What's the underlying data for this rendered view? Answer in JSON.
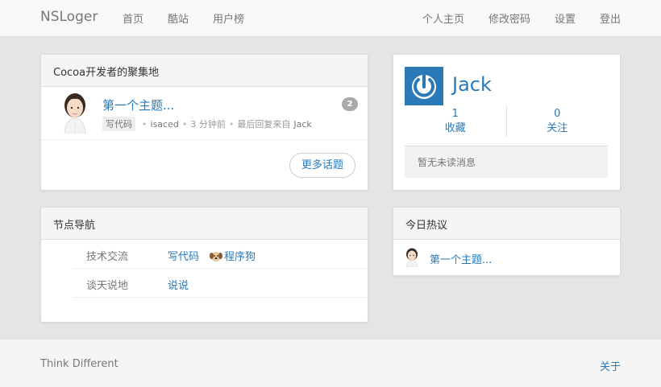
{
  "navbar": {
    "brand": "NSLoger",
    "left_links": [
      "首页",
      "酷站",
      "用户榜"
    ],
    "right_links": [
      "个人主页",
      "修改密码",
      "设置",
      "登出"
    ]
  },
  "topics_panel": {
    "heading": "Cocoa开发者的聚集地",
    "topics": [
      {
        "title": "第一个主题...",
        "node": "写代码",
        "author": "isaced",
        "time": "3 分钟前",
        "last_reply_label": "最后回复来自",
        "last_reply_user": "Jack",
        "reply_count": "2"
      }
    ],
    "more_button": "更多话题"
  },
  "user_panel": {
    "username": "Jack",
    "stats": [
      {
        "value": "1",
        "label": "收藏"
      },
      {
        "value": "0",
        "label": "关注"
      }
    ],
    "message": "暂无未读消息",
    "logo_icon": "power-icon",
    "logo_color": "#2b7ab8"
  },
  "nodes_panel": {
    "heading": "节点导航",
    "rows": [
      {
        "category": "技术交流",
        "nodes": [
          "写代码",
          "程序狗"
        ]
      },
      {
        "category": "谈天说地",
        "nodes": [
          "说说"
        ]
      }
    ]
  },
  "hot_panel": {
    "heading": "今日热议",
    "items": [
      {
        "title": "第一个主题..."
      }
    ]
  },
  "footer": {
    "slogan": "Think Different",
    "about": "关于"
  },
  "colors": {
    "link": "#2a7ab8",
    "background": "#e5e5e5"
  }
}
